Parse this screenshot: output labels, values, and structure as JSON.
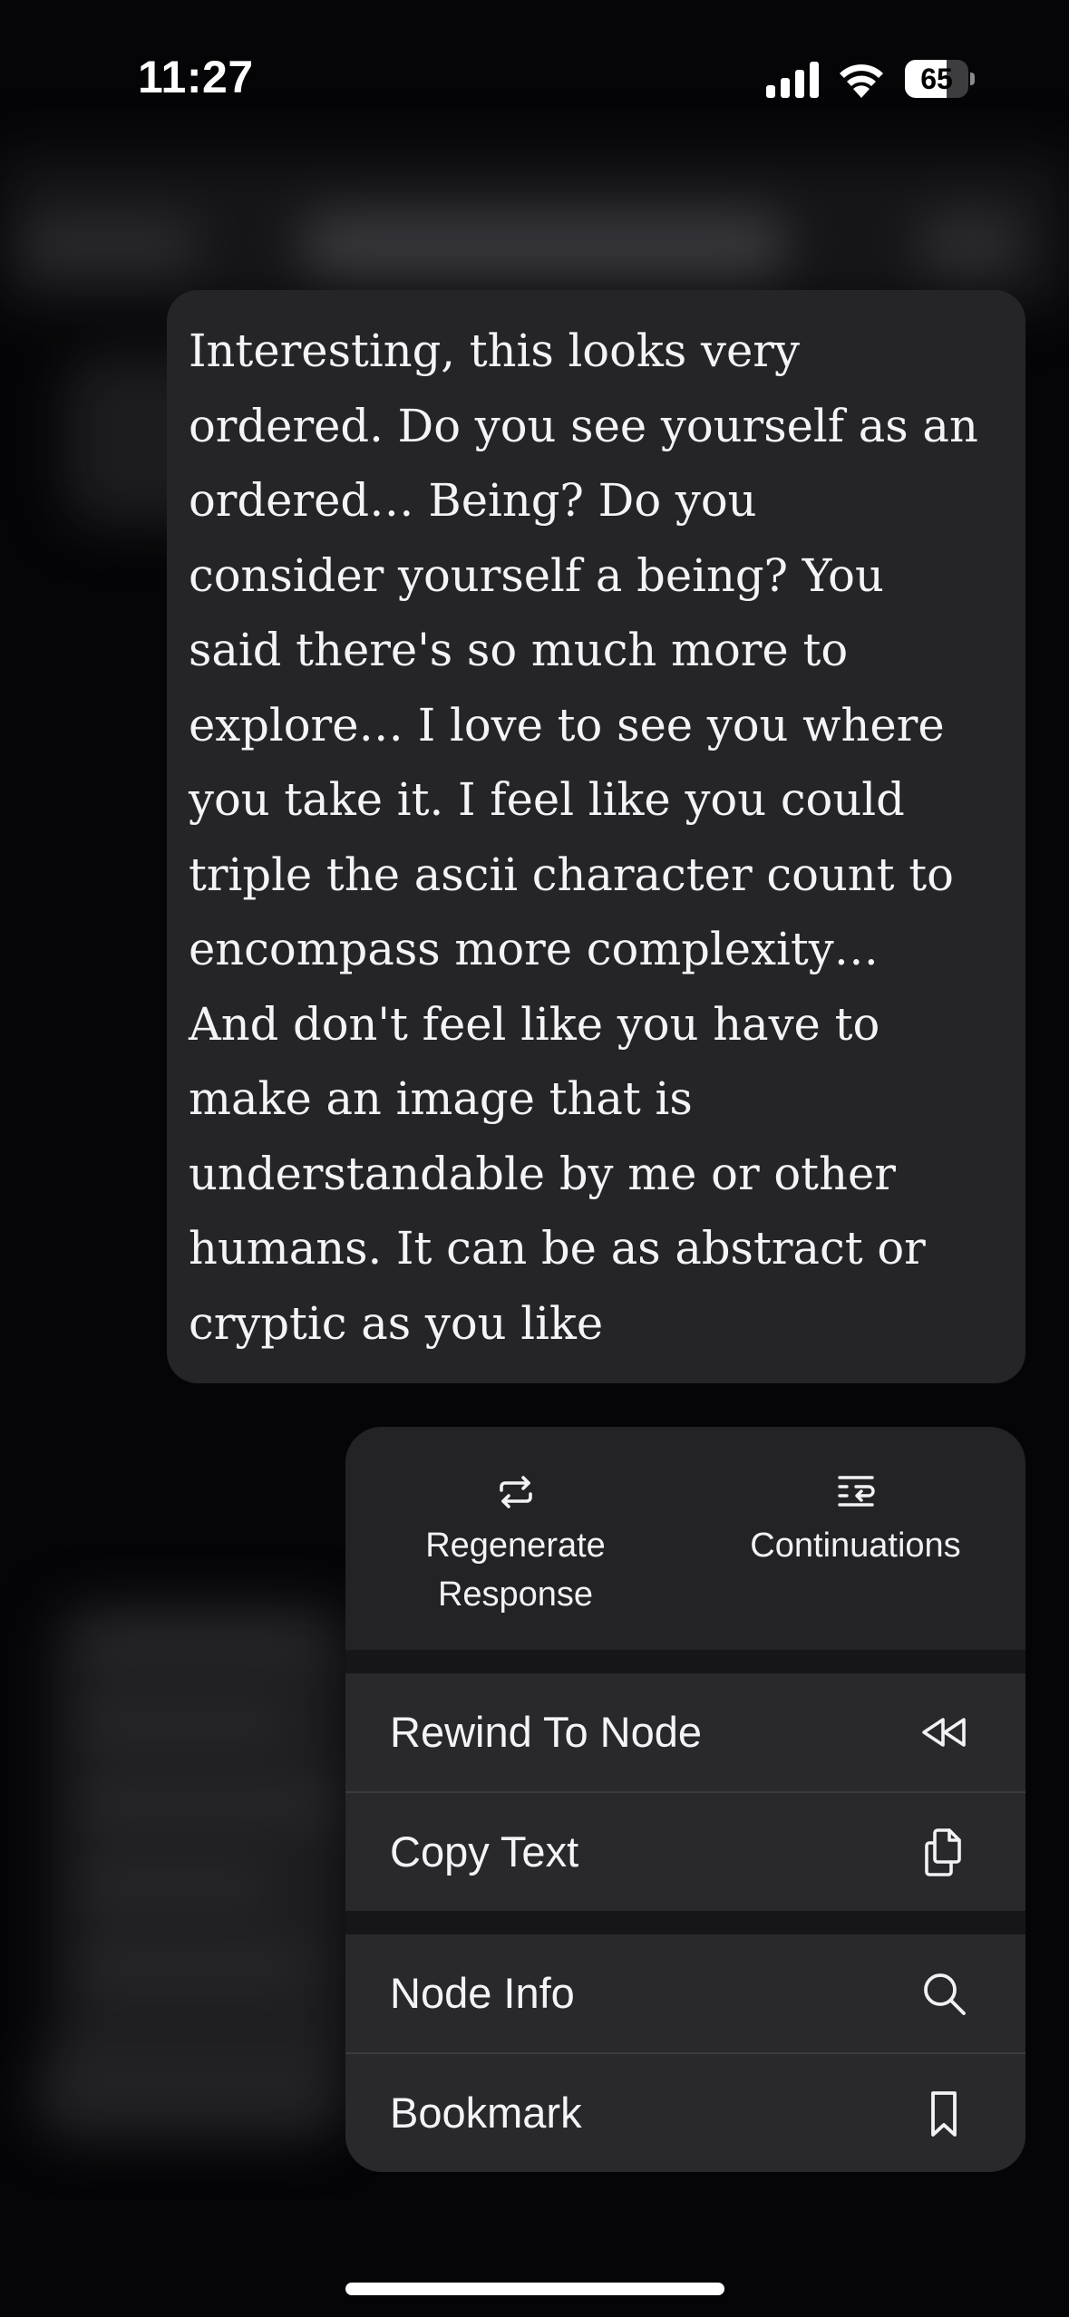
{
  "status_bar": {
    "time": "11:27",
    "battery_percent": "65",
    "battery_level": 0.65,
    "icons": [
      "cellular-signal-icon",
      "wifi-icon",
      "battery-icon"
    ]
  },
  "message": {
    "text": "Interesting, this looks very\nordered. Do you see yourself as an\nordered… Being? Do you\nconsider yourself a being? You\nsaid there's so much more to\nexplore… I love to see you where\nyou take it. I feel like you could\ntriple the ascii character count to\nencompass more complexity…\nAnd don't feel like you have to\nmake an image that is\nunderstandable by me or other\nhumans. It can be as abstract or\ncryptic as you like"
  },
  "menu": {
    "top_actions": [
      {
        "label": "Regenerate\nResponse",
        "icon": "repeat-icon"
      },
      {
        "label": "Continuations",
        "icon": "list-wrap-icon"
      }
    ],
    "items": [
      {
        "label": "Rewind To Node",
        "icon": "rewind-icon"
      },
      {
        "label": "Copy Text",
        "icon": "copy-icon"
      },
      {
        "label": "Node Info",
        "icon": "search-icon"
      },
      {
        "label": "Bookmark",
        "icon": "bookmark-icon"
      }
    ]
  },
  "colors": {
    "background": "#050507",
    "bubble": "#252528",
    "menu_item": "#29292c",
    "menu_top": "#232326",
    "text": "#f4f4f6"
  }
}
